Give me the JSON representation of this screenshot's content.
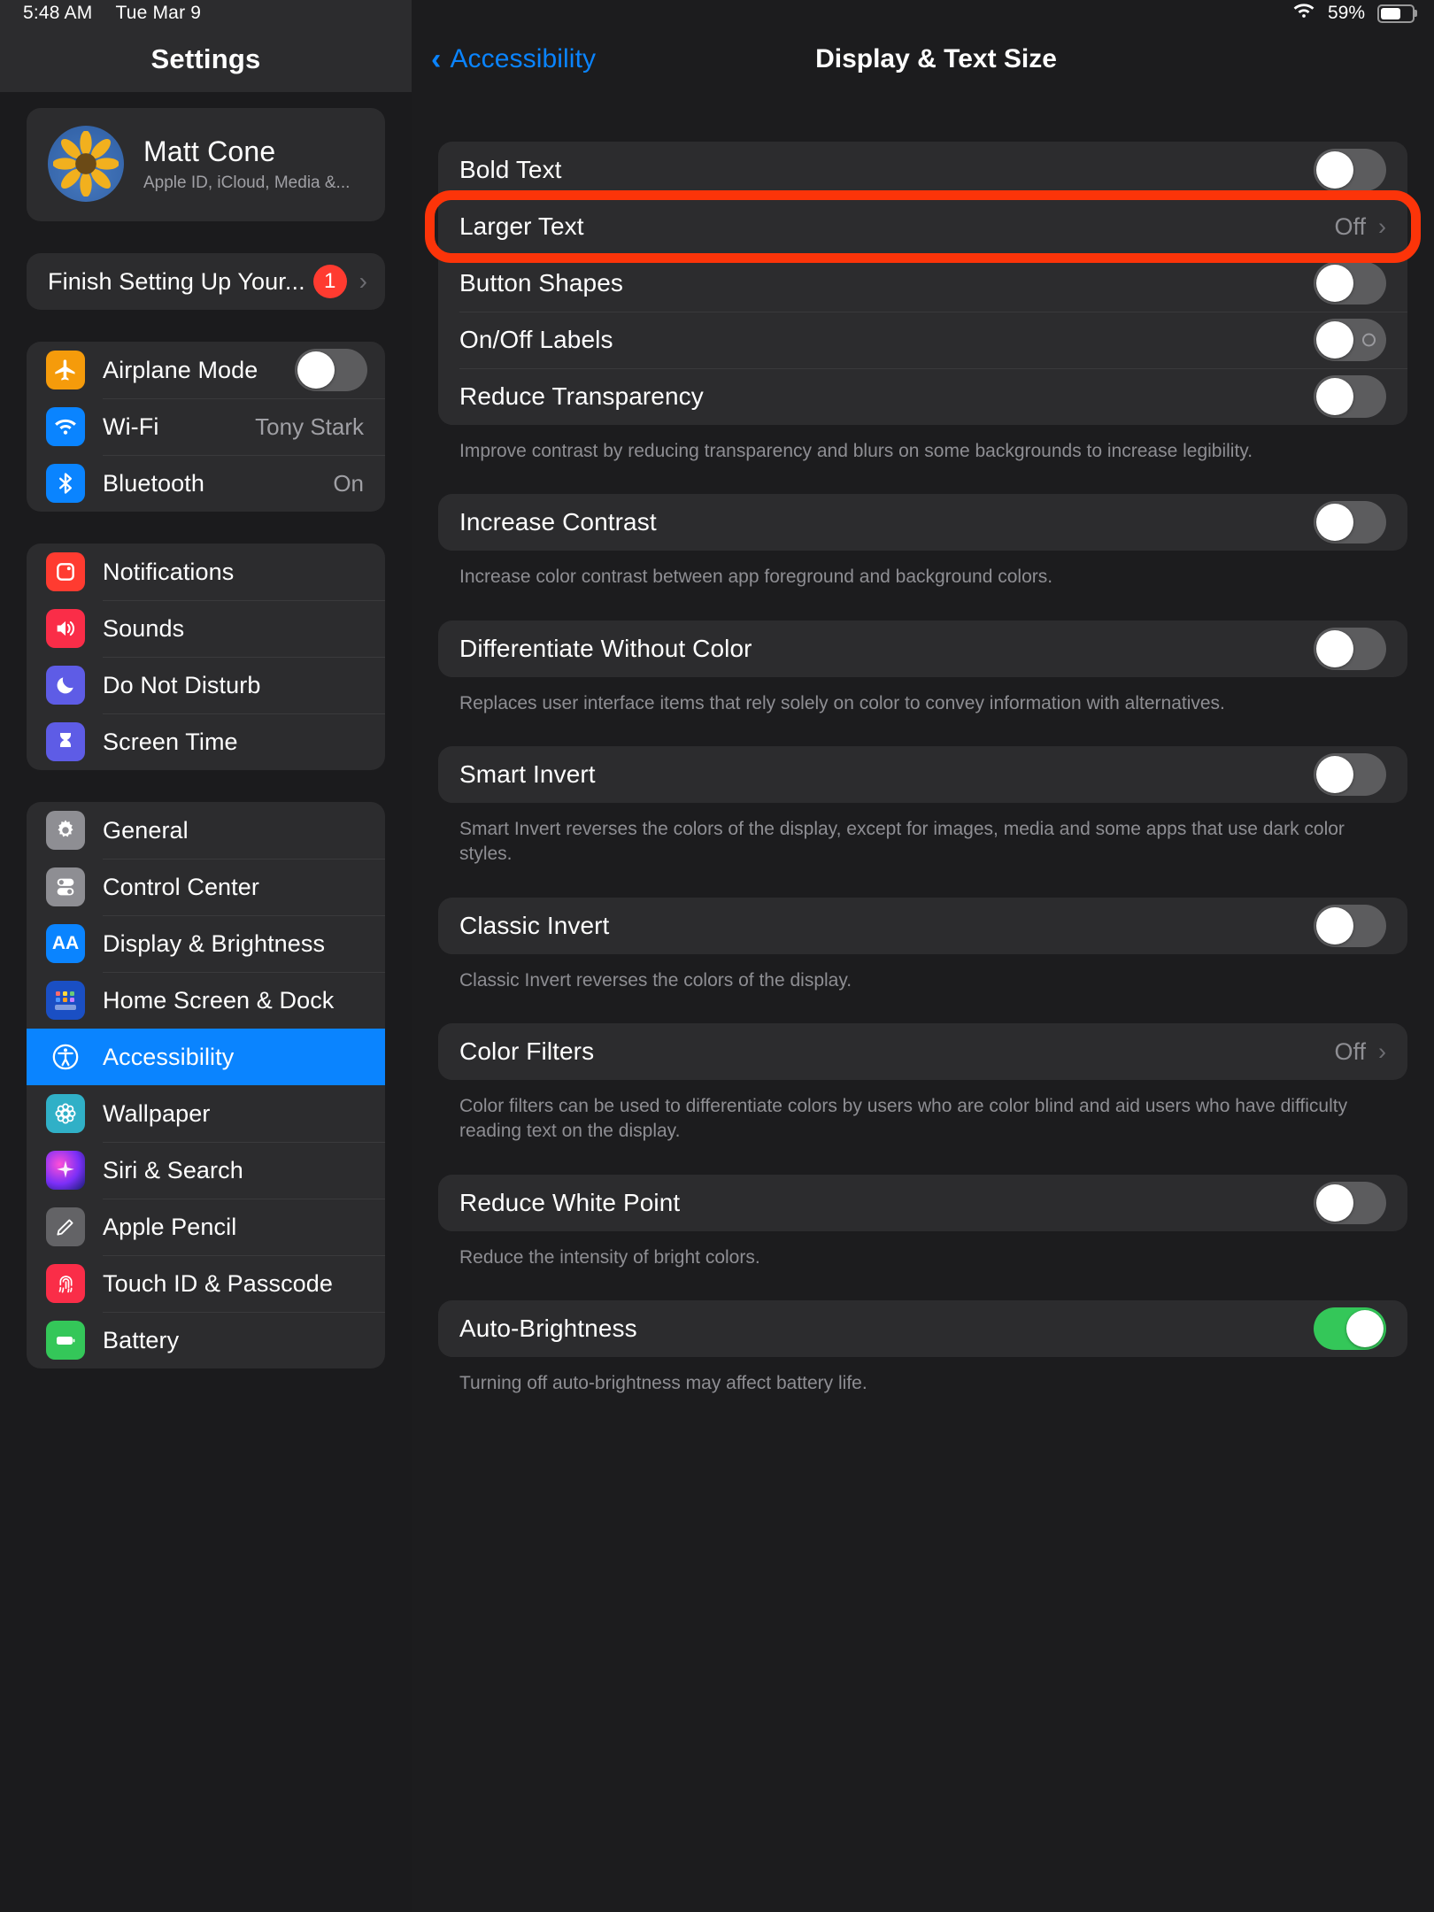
{
  "status_bar": {
    "time": "5:48 AM",
    "date": "Tue Mar 9",
    "wifi_icon": "wifi-icon",
    "battery_percent": "59%"
  },
  "sidebar": {
    "title": "Settings",
    "account": {
      "name": "Matt Cone",
      "subtitle": "Apple ID, iCloud, Media &..."
    },
    "setup_row": {
      "label": "Finish Setting Up Your...",
      "badge": "1",
      "chevron": "chevron-right-icon"
    },
    "groups": [
      {
        "items": [
          {
            "label": "Airplane Mode",
            "icon": "airplane-icon",
            "type": "toggle",
            "value": "off"
          },
          {
            "label": "Wi-Fi",
            "icon": "wifi-icon",
            "type": "value",
            "value": "Tony Stark"
          },
          {
            "label": "Bluetooth",
            "icon": "bluetooth-icon",
            "type": "value",
            "value": "On"
          }
        ]
      },
      {
        "items": [
          {
            "label": "Notifications",
            "icon": "notifications-icon",
            "type": "plain",
            "value": ""
          },
          {
            "label": "Sounds",
            "icon": "sounds-icon",
            "type": "plain",
            "value": ""
          },
          {
            "label": "Do Not Disturb",
            "icon": "moon-icon",
            "type": "plain",
            "value": ""
          },
          {
            "label": "Screen Time",
            "icon": "hourglass-icon",
            "type": "plain",
            "value": ""
          }
        ]
      },
      {
        "items": [
          {
            "label": "General",
            "icon": "gear-icon",
            "type": "plain",
            "value": ""
          },
          {
            "label": "Control Center",
            "icon": "control-center-icon",
            "type": "plain",
            "value": ""
          },
          {
            "label": "Display & Brightness",
            "icon": "display-brightness-icon",
            "type": "plain",
            "value": ""
          },
          {
            "label": "Home Screen & Dock",
            "icon": "home-screen-icon",
            "type": "plain",
            "value": ""
          },
          {
            "label": "Accessibility",
            "icon": "accessibility-icon",
            "type": "plain",
            "value": "",
            "selected": true
          },
          {
            "label": "Wallpaper",
            "icon": "wallpaper-icon",
            "type": "plain",
            "value": ""
          },
          {
            "label": "Siri & Search",
            "icon": "siri-icon",
            "type": "plain",
            "value": ""
          },
          {
            "label": "Apple Pencil",
            "icon": "apple-pencil-icon",
            "type": "plain",
            "value": ""
          },
          {
            "label": "Touch ID & Passcode",
            "icon": "touch-id-icon",
            "type": "plain",
            "value": ""
          },
          {
            "label": "Battery",
            "icon": "battery-icon",
            "type": "plain",
            "value": ""
          }
        ]
      }
    ]
  },
  "detail": {
    "back_label": "Accessibility",
    "back_icon": "chevron-left-icon",
    "title": "Display & Text Size",
    "sections": [
      {
        "rows": [
          {
            "label": "Bold Text",
            "type": "toggle",
            "value": "off"
          },
          {
            "label": "Larger Text",
            "type": "disclosure",
            "value": "Off",
            "highlighted": true
          },
          {
            "label": "Button Shapes",
            "type": "toggle",
            "value": "off"
          },
          {
            "label": "On/Off Labels",
            "type": "toggle",
            "value": "off",
            "off_mark": true
          },
          {
            "label": "Reduce Transparency",
            "type": "toggle",
            "value": "off"
          }
        ],
        "footnote": "Improve contrast by reducing transparency and blurs on some backgrounds to increase legibility."
      },
      {
        "rows": [
          {
            "label": "Increase Contrast",
            "type": "toggle",
            "value": "off"
          }
        ],
        "footnote": "Increase color contrast between app foreground and background colors."
      },
      {
        "rows": [
          {
            "label": "Differentiate Without Color",
            "type": "toggle",
            "value": "off"
          }
        ],
        "footnote": "Replaces user interface items that rely solely on color to convey information with alternatives."
      },
      {
        "rows": [
          {
            "label": "Smart Invert",
            "type": "toggle",
            "value": "off"
          }
        ],
        "footnote": "Smart Invert reverses the colors of the display, except for images, media and some apps that use dark color styles."
      },
      {
        "rows": [
          {
            "label": "Classic Invert",
            "type": "toggle",
            "value": "off"
          }
        ],
        "footnote": "Classic Invert reverses the colors of the display."
      },
      {
        "rows": [
          {
            "label": "Color Filters",
            "type": "disclosure",
            "value": "Off"
          }
        ],
        "footnote": "Color filters can be used to differentiate colors by users who are color blind and aid users who have difficulty reading text on the display."
      },
      {
        "rows": [
          {
            "label": "Reduce White Point",
            "type": "toggle",
            "value": "off"
          }
        ],
        "footnote": "Reduce the intensity of bright colors."
      },
      {
        "rows": [
          {
            "label": "Auto-Brightness",
            "type": "toggle",
            "value": "on"
          }
        ],
        "footnote": "Turning off auto-brightness may affect battery life."
      }
    ]
  },
  "annotation": {
    "color": "#fc3409",
    "target": "Larger Text"
  }
}
